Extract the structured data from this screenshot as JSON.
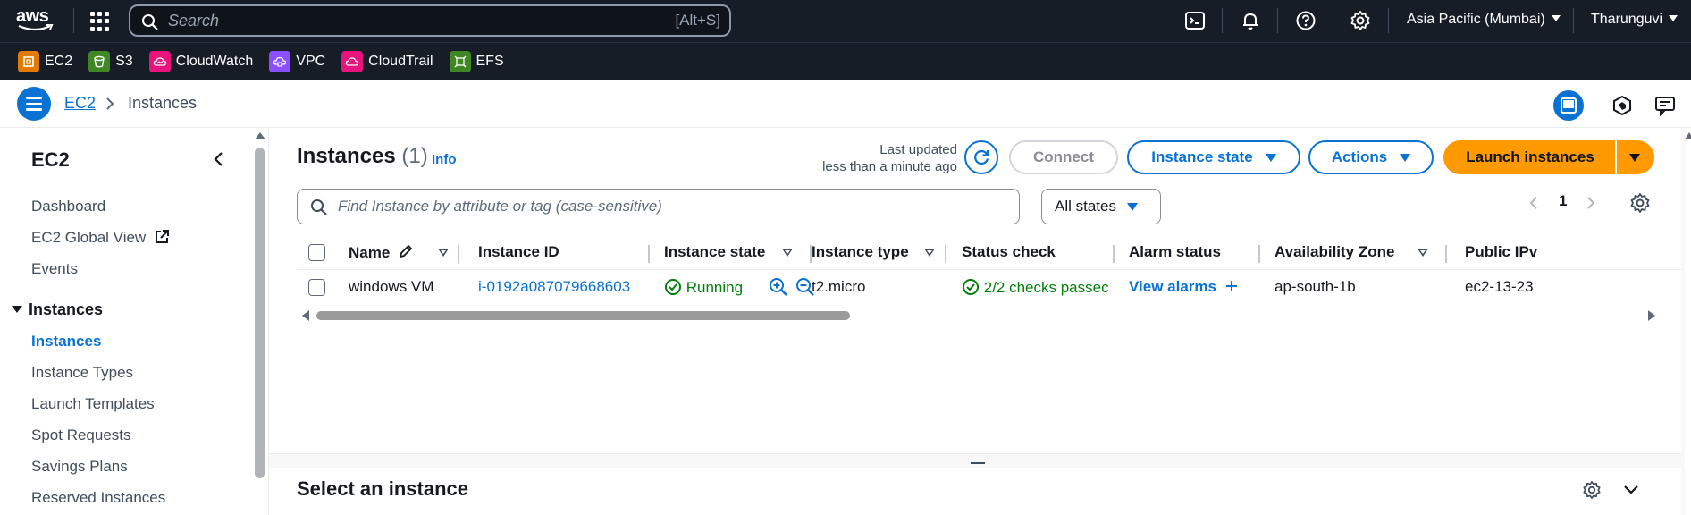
{
  "topbar": {
    "logo_text": "aws",
    "search_placeholder": "Search",
    "search_shortcut": "[Alt+S]",
    "region": "Asia Pacific (Mumbai)",
    "user": "Tharunguvi",
    "icons": [
      "cloudshell-icon",
      "bell-icon",
      "help-icon",
      "settings-icon"
    ]
  },
  "favorites": [
    {
      "label": "EC2",
      "color": "#e07b00"
    },
    {
      "label": "S3",
      "color": "#3f8624"
    },
    {
      "label": "CloudWatch",
      "color": "#e7157b"
    },
    {
      "label": "VPC",
      "color": "#8c4fff"
    },
    {
      "label": "CloudTrail",
      "color": "#e7157b"
    },
    {
      "label": "EFS",
      "color": "#3f8624"
    }
  ],
  "breadcrumb": {
    "link": "EC2",
    "current": "Instances"
  },
  "sidebar": {
    "title": "EC2",
    "items_top": [
      "Dashboard",
      "EC2 Global View",
      "Events"
    ],
    "section": "Instances",
    "section_items": [
      "Instances",
      "Instance Types",
      "Launch Templates",
      "Spot Requests",
      "Savings Plans",
      "Reserved Instances"
    ],
    "active": "Instances"
  },
  "header": {
    "title": "Instances",
    "count": "(1)",
    "info": "Info",
    "last_updated_1": "Last updated",
    "last_updated_2": "less than a minute ago",
    "connect": "Connect",
    "instance_state": "Instance state",
    "actions": "Actions",
    "launch": "Launch instances"
  },
  "filter": {
    "placeholder": "Find Instance by attribute or tag (case-sensitive)",
    "states": "All states",
    "page": "1"
  },
  "table": {
    "columns": [
      "Name",
      "Instance ID",
      "Instance state",
      "Instance type",
      "Status check",
      "Alarm status",
      "Availability Zone",
      "Public IPv"
    ],
    "rows": [
      {
        "name": "windows VM",
        "instance_id": "i-0192a087079668603",
        "state": "Running",
        "type": "t2.micro",
        "status": "2/2 checks passec",
        "alarm": "View alarms",
        "az": "ap-south-1b",
        "public": "ec2-13-23"
      }
    ]
  },
  "bottom": {
    "title": "Select an instance"
  },
  "colors": {
    "nav_bg": "#161d26",
    "accent": "#0972d3",
    "launch": "#ff9900",
    "running": "#037f0c"
  }
}
